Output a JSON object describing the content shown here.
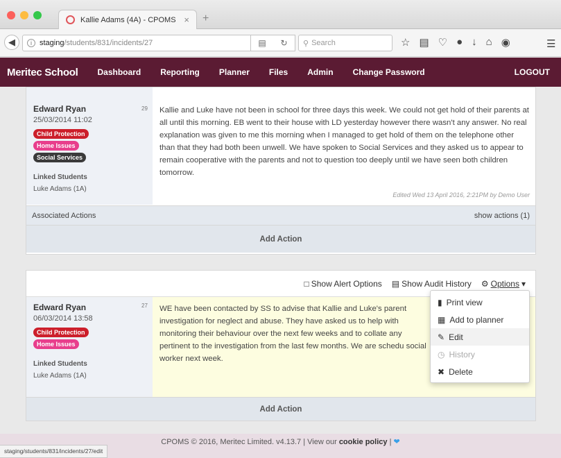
{
  "browser": {
    "tab_title": "Kallie Adams (4A) - CPOMS",
    "tab_close": "×",
    "new_tab": "+",
    "url_host": "staging",
    "url_path": "/students/831/incidents/27",
    "search_placeholder": "Search",
    "status_url": "staging/students/831/incidents/27/edit"
  },
  "header": {
    "brand": "Meritec School",
    "nav": [
      "Dashboard",
      "Reporting",
      "Planner",
      "Files",
      "Admin",
      "Change Password"
    ],
    "logout": "LOGOUT",
    "color": "#5b1b33"
  },
  "incident1": {
    "author": "Edward Ryan",
    "date": "25/03/2014 11:02",
    "number": "29",
    "badges": [
      "Child Protection",
      "Home Issues",
      "Social Services"
    ],
    "linked_label": "Linked Students",
    "linked_student": "Luke Adams (1A)",
    "text": "Kallie and Luke have not been in school for three days this week. We could not get hold of their parents at all until this morning. EB went to their house with LD yesterday however there wasn't any answer. No real explanation was given to me this morning when I managed to get hold of them on the telephone other than that they had both been unwell. We have spoken to Social Services and they asked us to appear to remain cooperative with the parents and not to question too deeply until we have seen both children tomorrow.",
    "edited": "Edited Wed 13 April 2016, 2:21PM by Demo User",
    "associated_actions": "Associated Actions",
    "show_actions": "show actions (1)",
    "add_action": "Add Action"
  },
  "incident2": {
    "toolbar": {
      "alert": "Show Alert Options",
      "audit": "Show Audit History",
      "options": "Options"
    },
    "author": "Edward Ryan",
    "date": "06/03/2014 13:58",
    "number": "27",
    "badges": [
      "Child Protection",
      "Home Issues"
    ],
    "linked_label": "Linked Students",
    "linked_student": "Luke Adams (1A)",
    "text": "WE have been contacted by SS to advise that Kallie and Luke's parent investigation for neglect and abuse. They have asked us to help with monitoring their behaviour over the next few weeks and to collate any pertinent to the investigation from the last few months. We are schedu social worker next week.",
    "add_action": "Add Action"
  },
  "dropdown": [
    "Print view",
    "Add to planner",
    "Edit",
    "History",
    "Delete"
  ],
  "footer": {
    "text": "CPOMS © 2016, Meritec Limited. v4.13.7 | View our",
    "link": "cookie policy",
    "after": "|"
  },
  "colors": {
    "child_protection": "#cc1f2b",
    "home_issues": "#e83e8c",
    "social_services": "#3a3a3a"
  }
}
